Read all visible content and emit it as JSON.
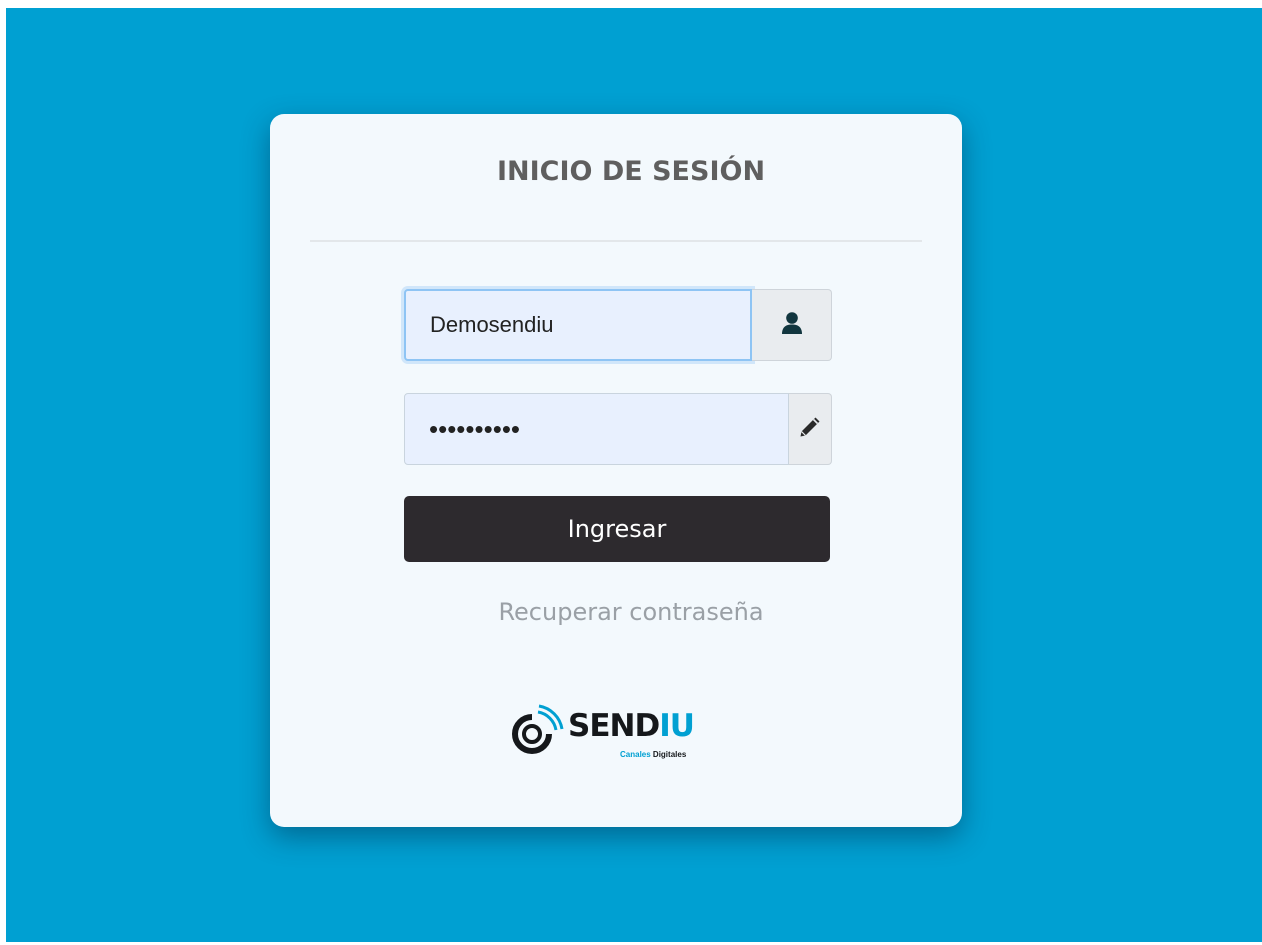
{
  "login": {
    "title": "INICIO DE SESIÓN",
    "username": {
      "value": "Demosendiu",
      "icon": "user-icon"
    },
    "password": {
      "value": "••••••••••",
      "icon": "pencil-icon"
    },
    "submit_label": "Ingresar",
    "recover_label": "Recuperar contraseña"
  },
  "brand": {
    "name_main": "SEND",
    "name_accent": "IU",
    "tagline_accent": "Canales",
    "tagline_rest": "Digitales",
    "colors": {
      "background": "#00a0d2",
      "accent": "#00a0d2",
      "button": "#2d2a2e"
    }
  }
}
